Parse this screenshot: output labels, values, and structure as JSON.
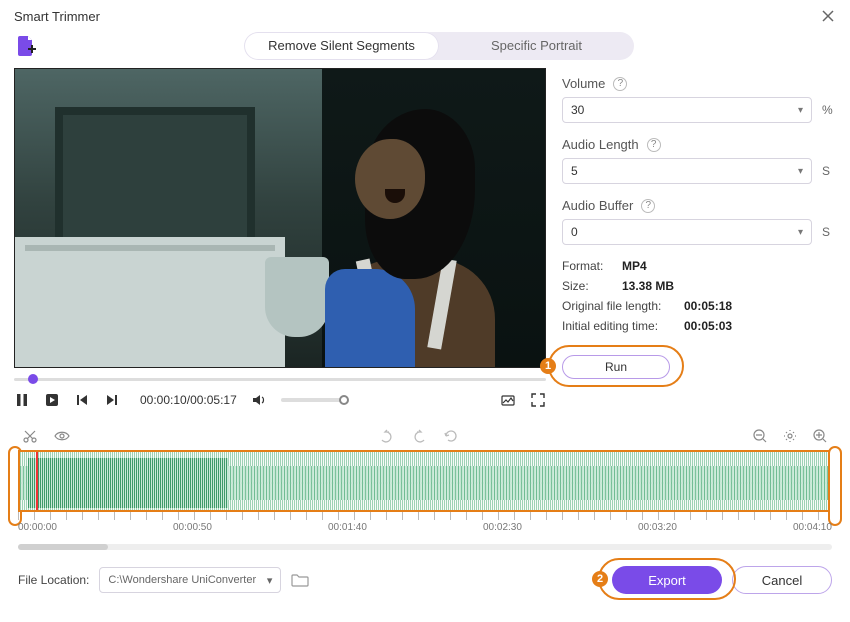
{
  "window": {
    "title": "Smart Trimmer"
  },
  "modes": {
    "remove_silent": "Remove Silent Segments",
    "specific_portrait": "Specific Portrait"
  },
  "side": {
    "volume_label": "Volume",
    "volume_value": "30",
    "volume_unit": "%",
    "audio_length_label": "Audio Length",
    "audio_length_value": "5",
    "audio_length_unit": "S",
    "audio_buffer_label": "Audio Buffer",
    "audio_buffer_value": "0",
    "audio_buffer_unit": "S",
    "format_label": "Format:",
    "format_value": "MP4",
    "size_label": "Size:",
    "size_value": "13.38 MB",
    "orig_len_label": "Original file length:",
    "orig_len_value": "00:05:18",
    "init_edit_label": "Initial editing time:",
    "init_edit_value": "00:05:03",
    "run_label": "Run"
  },
  "playback": {
    "current": "00:00:10",
    "total": "00:05:17"
  },
  "ruler": {
    "labels": [
      "00:00:00",
      "00:00:50",
      "00:01:40",
      "00:02:30",
      "00:03:20",
      "00:04:10"
    ]
  },
  "footer": {
    "location_label": "File Location:",
    "path": "C:\\Wondershare UniConverter",
    "export_label": "Export",
    "cancel_label": "Cancel"
  },
  "callouts": {
    "one": "1",
    "two": "2"
  }
}
